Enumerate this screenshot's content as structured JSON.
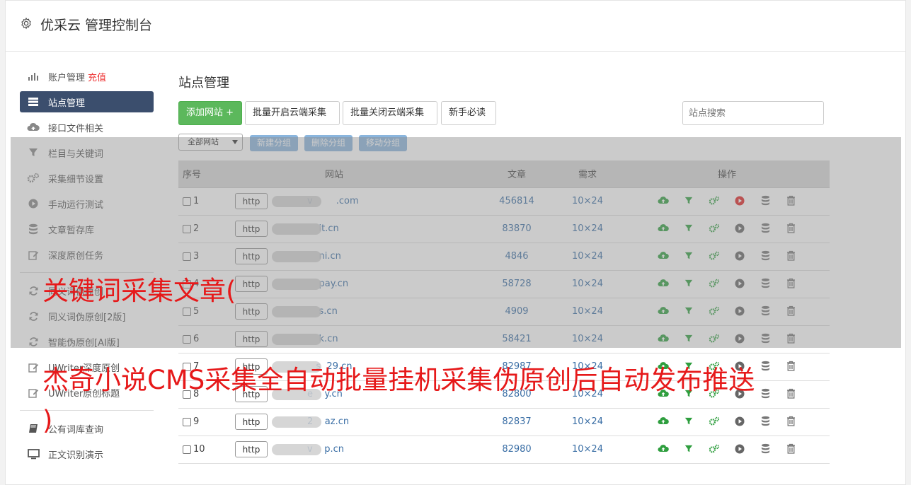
{
  "app": {
    "title": "优采云 管理控制台"
  },
  "sidebar": {
    "items": [
      {
        "label": "账户管理",
        "extra": "充值",
        "icon": "bar-chart-icon"
      },
      {
        "label": "站点管理",
        "icon": "server-icon",
        "active": true
      },
      {
        "label": "接口文件相关",
        "icon": "cloud-upload-icon"
      },
      {
        "label": "栏目与关键词",
        "icon": "filter-icon"
      },
      {
        "label": "采集细节设置",
        "icon": "gears-icon"
      },
      {
        "label": "手动运行测试",
        "icon": "play-icon"
      },
      {
        "label": "文章暂存库",
        "icon": "database-icon"
      },
      {
        "label": "深度原创任务",
        "icon": "edit-icon"
      },
      {
        "label": "同义词伪原创",
        "icon": "refresh-icon"
      },
      {
        "label": "同义词伪原创[2版]",
        "icon": "refresh-icon"
      },
      {
        "label": "智能伪原创[AI版]",
        "icon": "refresh-icon"
      },
      {
        "label": "UWriter深度原创",
        "icon": "edit-icon"
      },
      {
        "label": "UWriter原创标题",
        "icon": "edit-icon"
      },
      {
        "label": "公有词库查询",
        "icon": "book-icon"
      },
      {
        "label": "正文识别演示",
        "icon": "monitor-icon"
      }
    ]
  },
  "main": {
    "title": "站点管理",
    "toolbar": {
      "add": "添加网站 +",
      "batch_open": "批量开启云端采集",
      "batch_close": "批量关闭云端采集",
      "newbie": "新手必读",
      "search_placeholder": "站点搜索"
    },
    "groups": {
      "select": "全部网站",
      "new": "新建分组",
      "delete": "删除分组",
      "move": "移动分组"
    },
    "table": {
      "headers": {
        "no": "序号",
        "site": "网站",
        "articles": "文章",
        "req": "需求",
        "ops": "操作"
      },
      "rows": [
        {
          "no": "1",
          "scheme": "http",
          "domain": "v        .com",
          "articles": "456814",
          "req": "10×24",
          "running": true
        },
        {
          "no": "2",
          "scheme": "http",
          "domain": "    it.cn",
          "articles": "83870",
          "req": "10×24",
          "running": false
        },
        {
          "no": "3",
          "scheme": "http",
          "domain": "    ni.cn",
          "articles": "4846",
          "req": "10×24",
          "running": false
        },
        {
          "no": "4",
          "scheme": "http",
          "domain": "    pay.cn",
          "articles": "58728",
          "req": "10×24",
          "running": false
        },
        {
          "no": "5",
          "scheme": "http",
          "domain": "    s.cn",
          "articles": "4909",
          "req": "10×24",
          "running": false
        },
        {
          "no": "6",
          "scheme": "http",
          "domain": "    k.cn",
          "articles": "58421",
          "req": "10×24",
          "running": false
        },
        {
          "no": "7",
          "scheme": "http",
          "domain": "   s  29.cn",
          "articles": "82987",
          "req": "10×24",
          "running": false
        },
        {
          "no": "8",
          "scheme": "http",
          "domain": "e    y.cn",
          "articles": "82800",
          "req": "10×24",
          "running": false
        },
        {
          "no": "9",
          "scheme": "http",
          "domain": "2    az.cn",
          "articles": "82837",
          "req": "10×24",
          "running": false
        },
        {
          "no": "10",
          "scheme": "http",
          "domain": "v    p.cn",
          "articles": "82980",
          "req": "10×24",
          "running": false
        }
      ]
    }
  },
  "watermark": {
    "line1": "关键词采集文章(",
    "line2": "杰奇小说CMS采集全自动批量挂机采集伪原创后自动发布推送",
    "line3": ")"
  },
  "colors": {
    "active_nav": "#3b4e6d",
    "green": "#5cb85c",
    "link": "#3a6ea5",
    "red": "#e6191a"
  }
}
